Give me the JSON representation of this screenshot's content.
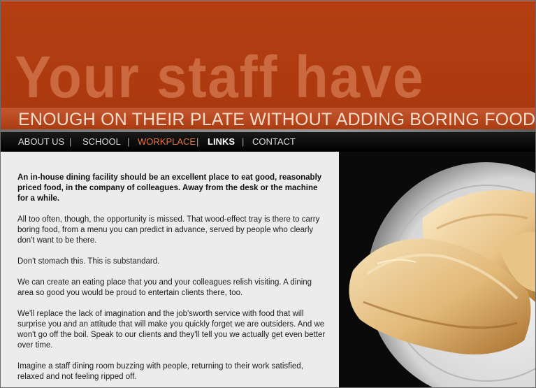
{
  "header": {
    "headline": "Your staff have",
    "tagline": "ENOUGH ON THEIR PLATE WITHOUT ADDING BORING FOOD"
  },
  "nav": {
    "items": [
      {
        "label": "ABOUT US"
      },
      {
        "label": "SCHOOL"
      },
      {
        "label": "WORKPLACE"
      },
      {
        "label": "LINKS"
      },
      {
        "label": "CONTACT"
      }
    ],
    "separator": "|",
    "active_color": "#e8743f"
  },
  "content": {
    "paragraphs": [
      "An in-house dining facility should be an excellent place to eat good, reasonably priced food, in the company of colleagues. Away from the desk or the machine for a while.",
      "All too often, though, the opportunity is missed. That wood-effect tray is there to carry boring food, from a menu you can predict in advance, served by people who clearly don't want to be there.",
      "Don't stomach this. This is substandard.",
      "We can create an eating place that you and your colleagues relish visiting. A dining area so good you would be proud to entertain clients there, too.",
      "We'll replace the lack of imagination and the job'sworth service with food that will surprise you and an attitude that will make you quickly forget we are outsiders. And we won't go off the boil. Speak to our clients and they'll tell you we actually get even better over time.",
      "Imagine a staff dining room buzzing with people, returning to their work satisfied, relaxed and not feeling ripped off."
    ]
  },
  "colors": {
    "header_bg": "#b43e12",
    "headline": "#cb6a40",
    "tagline": "#f4dccb",
    "nav_bg": "#000000",
    "content_bg": "#ececec"
  },
  "photo": {
    "icon": "bread-plate-photo"
  }
}
